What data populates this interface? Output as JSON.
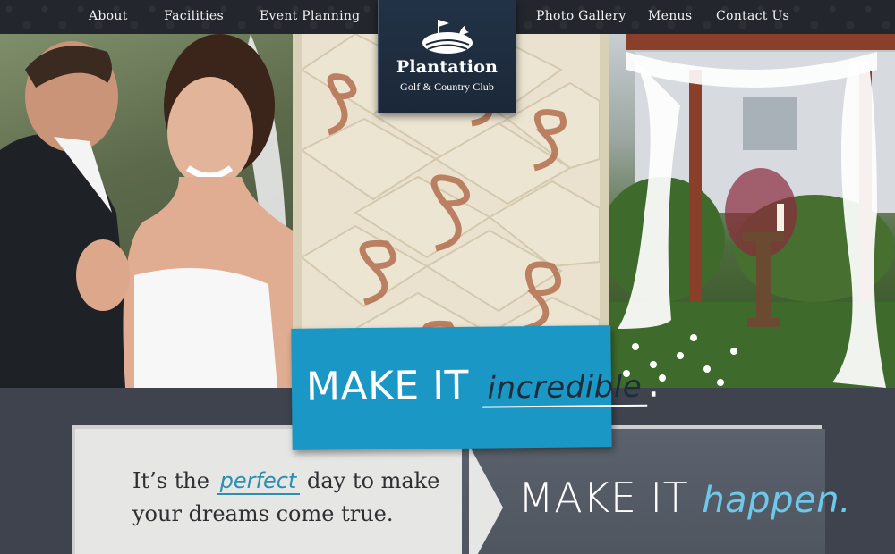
{
  "nav": {
    "items": [
      {
        "label": "About"
      },
      {
        "label": "Facilities"
      },
      {
        "label": "Event Planning"
      },
      {
        "label": "Photo Gallery"
      },
      {
        "label": "Menus"
      },
      {
        "label": "Contact Us"
      }
    ]
  },
  "logo": {
    "name": "Plantation",
    "subtitle": "Golf & Country Club",
    "icon": "golf-flag-sailboat-icon"
  },
  "banner": {
    "lead": "MAKE IT",
    "script": "incredible",
    "end": "."
  },
  "content": {
    "tagline_pre": "It’s the",
    "tagline_accent": "perfect",
    "tagline_post": "day to make your dreams come true.",
    "happen_lead": "MAKE IT",
    "happen_script": "happen."
  },
  "colors": {
    "nav_bg": "#23262c",
    "accent_blue": "#1a97c4",
    "accent_light_blue": "#6ec8ea",
    "panel_dark": "#565c66"
  }
}
